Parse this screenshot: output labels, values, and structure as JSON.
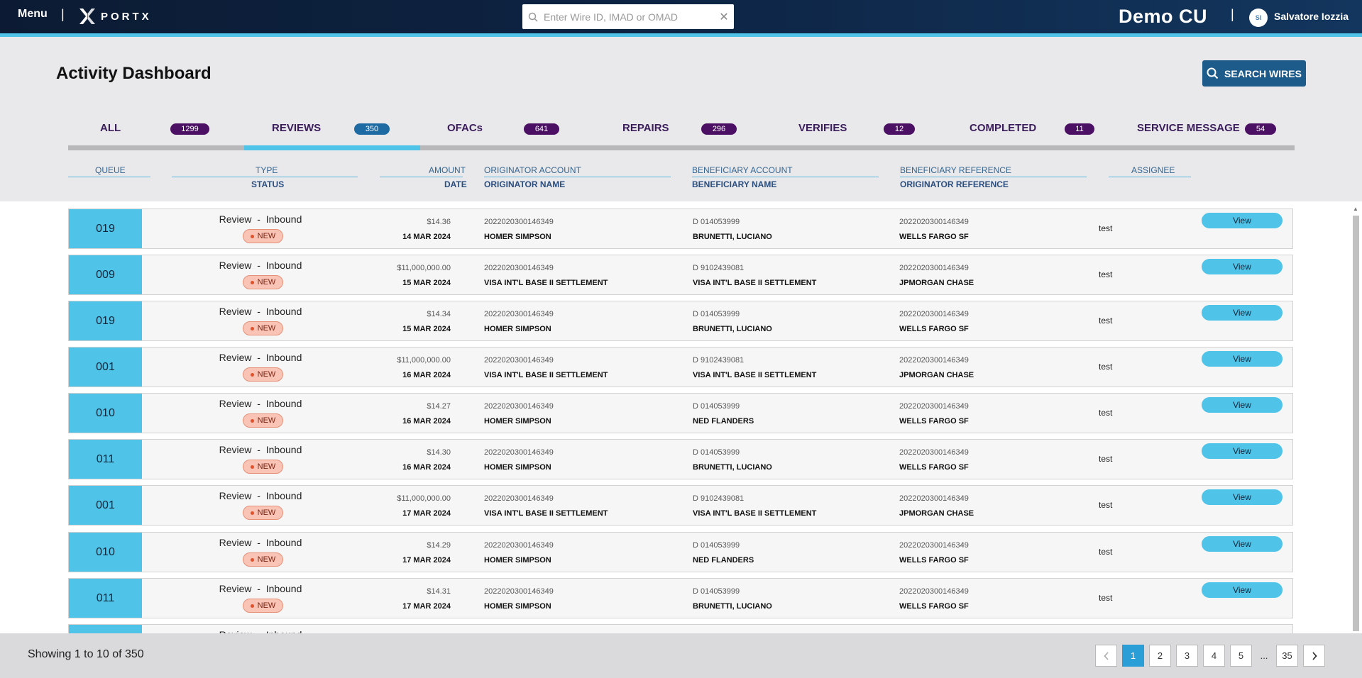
{
  "topbar": {
    "menu_label": "Menu",
    "logo_text": "PORTX",
    "search_placeholder": "Enter Wire ID, IMAD or OMAD",
    "org_name": "Demo CU",
    "user_initials": "SI",
    "user_name": "Salvatore Iozzia"
  },
  "header": {
    "title": "Activity Dashboard",
    "search_wires_label": "SEARCH WIRES"
  },
  "tabs": [
    {
      "label": "ALL",
      "count": "1299"
    },
    {
      "label": "REVIEWS",
      "count": "350",
      "active": true
    },
    {
      "label": "OFACs",
      "count": "641"
    },
    {
      "label": "REPAIRS",
      "count": "296"
    },
    {
      "label": "VERIFIES",
      "count": "12"
    },
    {
      "label": "COMPLETED",
      "count": "11"
    },
    {
      "label": "SERVICE MESSAGE",
      "count": "54"
    }
  ],
  "columns": {
    "queue": "QUEUE",
    "type": "TYPE",
    "status": "STATUS",
    "amount": "AMOUNT",
    "date": "DATE",
    "originator_account": "ORIGINATOR ACCOUNT",
    "originator_name": "ORIGINATOR NAME",
    "beneficiary_account": "BENEFICIARY ACCOUNT",
    "beneficiary_name": "BENEFICIARY NAME",
    "beneficiary_reference": "BENEFICIARY REFERENCE",
    "originator_reference": "ORIGINATOR REFERENCE",
    "assignee": "ASSIGNEE"
  },
  "rows": [
    {
      "queue": "019",
      "type": "Review  -  Inbound",
      "status": "NEW",
      "amount": "$14.36",
      "date": "14 MAR 2024",
      "orig_account": "2022020300146349",
      "orig_name": "HOMER SIMPSON",
      "ben_account": "D 014053999",
      "ben_name": "BRUNETTI, LUCIANO",
      "ben_ref": "2022020300146349",
      "orig_ref": "WELLS FARGO SF",
      "assignee": "test",
      "action": "View"
    },
    {
      "queue": "009",
      "type": "Review  -  Inbound",
      "status": "NEW",
      "amount": "$11,000,000.00",
      "date": "15 MAR 2024",
      "orig_account": "2022020300146349",
      "orig_name": "VISA INT'L BASE II SETTLEMENT",
      "ben_account": "D 9102439081",
      "ben_name": "VISA INT'L BASE II SETTLEMENT",
      "ben_ref": "2022020300146349",
      "orig_ref": "JPMORGAN CHASE",
      "assignee": "test",
      "action": "View"
    },
    {
      "queue": "019",
      "type": "Review  -  Inbound",
      "status": "NEW",
      "amount": "$14.34",
      "date": "15 MAR 2024",
      "orig_account": "2022020300146349",
      "orig_name": "HOMER SIMPSON",
      "ben_account": "D 014053999",
      "ben_name": "BRUNETTI, LUCIANO",
      "ben_ref": "2022020300146349",
      "orig_ref": "WELLS FARGO SF",
      "assignee": "test",
      "action": "View"
    },
    {
      "queue": "001",
      "type": "Review  -  Inbound",
      "status": "NEW",
      "amount": "$11,000,000.00",
      "date": "16 MAR 2024",
      "orig_account": "2022020300146349",
      "orig_name": "VISA INT'L BASE II SETTLEMENT",
      "ben_account": "D 9102439081",
      "ben_name": "VISA INT'L BASE II SETTLEMENT",
      "ben_ref": "2022020300146349",
      "orig_ref": "JPMORGAN CHASE",
      "assignee": "test",
      "action": "View"
    },
    {
      "queue": "010",
      "type": "Review  -  Inbound",
      "status": "NEW",
      "amount": "$14.27",
      "date": "16 MAR 2024",
      "orig_account": "2022020300146349",
      "orig_name": "HOMER SIMPSON",
      "ben_account": "D 014053999",
      "ben_name": "NED FLANDERS",
      "ben_ref": "2022020300146349",
      "orig_ref": "WELLS FARGO SF",
      "assignee": "test",
      "action": "View"
    },
    {
      "queue": "011",
      "type": "Review  -  Inbound",
      "status": "NEW",
      "amount": "$14.30",
      "date": "16 MAR 2024",
      "orig_account": "2022020300146349",
      "orig_name": "HOMER SIMPSON",
      "ben_account": "D 014053999",
      "ben_name": "BRUNETTI, LUCIANO",
      "ben_ref": "2022020300146349",
      "orig_ref": "WELLS FARGO SF",
      "assignee": "test",
      "action": "View"
    },
    {
      "queue": "001",
      "type": "Review  -  Inbound",
      "status": "NEW",
      "amount": "$11,000,000.00",
      "date": "17 MAR 2024",
      "orig_account": "2022020300146349",
      "orig_name": "VISA INT'L BASE II SETTLEMENT",
      "ben_account": "D 9102439081",
      "ben_name": "VISA INT'L BASE II SETTLEMENT",
      "ben_ref": "2022020300146349",
      "orig_ref": "JPMORGAN CHASE",
      "assignee": "test",
      "action": "View"
    },
    {
      "queue": "010",
      "type": "Review  -  Inbound",
      "status": "NEW",
      "amount": "$14.29",
      "date": "17 MAR 2024",
      "orig_account": "2022020300146349",
      "orig_name": "HOMER SIMPSON",
      "ben_account": "D 014053999",
      "ben_name": "NED FLANDERS",
      "ben_ref": "2022020300146349",
      "orig_ref": "WELLS FARGO SF",
      "assignee": "test",
      "action": "View"
    },
    {
      "queue": "011",
      "type": "Review  -  Inbound",
      "status": "NEW",
      "amount": "$14.31",
      "date": "17 MAR 2024",
      "orig_account": "2022020300146349",
      "orig_name": "HOMER SIMPSON",
      "ben_account": "D 014053999",
      "ben_name": "BRUNETTI, LUCIANO",
      "ben_ref": "2022020300146349",
      "orig_ref": "WELLS FARGO SF",
      "assignee": "test",
      "action": "View"
    },
    {
      "queue": "",
      "type": "Review  -  Inbound",
      "status": "",
      "amount": "",
      "date": "",
      "orig_account": "",
      "orig_name": "",
      "ben_account": "",
      "ben_name": "",
      "ben_ref": "",
      "orig_ref": "",
      "assignee": "",
      "action": ""
    }
  ],
  "footer": {
    "showing": "Showing 1 to 10 of 350",
    "pages": [
      "1",
      "2",
      "3",
      "4",
      "5",
      "...",
      "35"
    ],
    "current_page": "1"
  },
  "colors": {
    "accent": "#4fc3e8",
    "navy": "#0d2342",
    "tab_badge": "#4b0f63",
    "new_badge": "#f9c3b5"
  }
}
